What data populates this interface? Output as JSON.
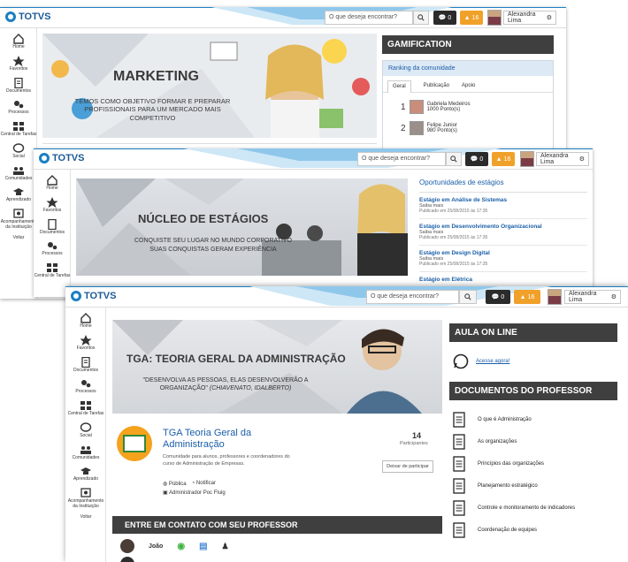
{
  "app": {
    "logo_text": "TOTVS"
  },
  "topbar": {
    "search_placeholder": "O que deseja encontrar?",
    "messages_count": "0",
    "alerts_count": "16",
    "user_name": "Alexandra Lima"
  },
  "colors": {
    "accent": "#1b7fc2",
    "dark_panel": "#3f3f3f",
    "alert": "#f0a12a"
  },
  "sidebar": {
    "items": [
      {
        "label": "Home",
        "icon": "home-icon"
      },
      {
        "label": "Favoritos",
        "icon": "star-icon"
      },
      {
        "label": "Documentos",
        "icon": "document-icon"
      },
      {
        "label": "Processos",
        "icon": "gears-icon"
      },
      {
        "label": "Central de Tarefas",
        "icon": "tasks-icon"
      },
      {
        "label": "Social",
        "icon": "chat-icon"
      },
      {
        "label": "Comunidades",
        "icon": "community-icon"
      },
      {
        "label": "Aprendizado",
        "icon": "graduation-icon"
      },
      {
        "label": "Acompanhamento da Instituição",
        "icon": "monitor-icon"
      },
      {
        "label": "Voltar",
        "icon": ""
      }
    ]
  },
  "screen1": {
    "banner_title": "MARKETING",
    "banner_text": "TEMOS COMO OBJETIVO FORMAR E PREPARAR PROFISSIONAIS PARA UM MERCADO MAIS COMPETITIVO",
    "gamification_title": "GAMIFICATION",
    "ranking_title": "Ranking da comunidade",
    "tabs": [
      "Geral",
      "Publicação",
      "Apoio"
    ],
    "ranking": [
      {
        "pos": "1",
        "name": "Gabriela Medeiros",
        "points": "1000 Ponto(s)"
      },
      {
        "pos": "2",
        "name": "Felipe Junior",
        "points": "980 Ponto(s)"
      }
    ]
  },
  "screen2": {
    "banner_title": "NÚCLEO DE ESTÁGIOS",
    "banner_line1": "CONQUISTE SEU LUGAR NO MUNDO CORPORATIVO",
    "banner_line2": "SUAS CONQUISTAS GERAM EXPERIÊNCIA",
    "panel_title": "Oportunidades de estágios",
    "items": [
      {
        "title": "Estágio em Análise de Sistemas",
        "more": "Saiba mais",
        "date": "Publicado em 25/08/2015 às 17:35"
      },
      {
        "title": "Estágio em Desenvolvimento Organizacional",
        "more": "Saiba mais",
        "date": "Publicado em 25/08/2015 às 17:35"
      },
      {
        "title": "Estágio em Design Digital",
        "more": "Saiba mais",
        "date": "Publicado em 25/08/2015 às 17:35"
      },
      {
        "title": "Estágio em Elétrica",
        "more": "",
        "date": ""
      }
    ]
  },
  "screen3": {
    "banner_title": "TGA: TEORIA GERAL DA ADMINISTRAÇÃO",
    "banner_quote": "\"DESENVOLVA AS PESSOAS, ELAS DESENVOLVERÃO A ORGANIZAÇÃO\"",
    "banner_author": "(CHIAVENATO, IDALBERTO)",
    "community_name": "TGA Teoria Geral da Administração",
    "community_desc": "Comunidade para alunos, professores e coordenadores do curso de Administração de Empresas.",
    "participants_count": "14",
    "participants_label": "Participantes",
    "leave_button": "Deixar de participar",
    "public_label": "Pública",
    "notify_label": "Notificar",
    "admin_label": "Administrador Poc Fluig",
    "contact_title": "ENTRE EM CONTATO COM SEU PROFESSOR",
    "contact_name": "João",
    "aula_title": "AULA ON LINE",
    "aula_link": "Acesse agora!",
    "docs_title": "DOCUMENTOS DO PROFESSOR",
    "docs": [
      "O que é Administração",
      "As organizações",
      "Princípios das organizações",
      "Planejamento estratégico",
      "Controle e monitoramento de indicadores",
      "Coordenação de equipes"
    ]
  }
}
